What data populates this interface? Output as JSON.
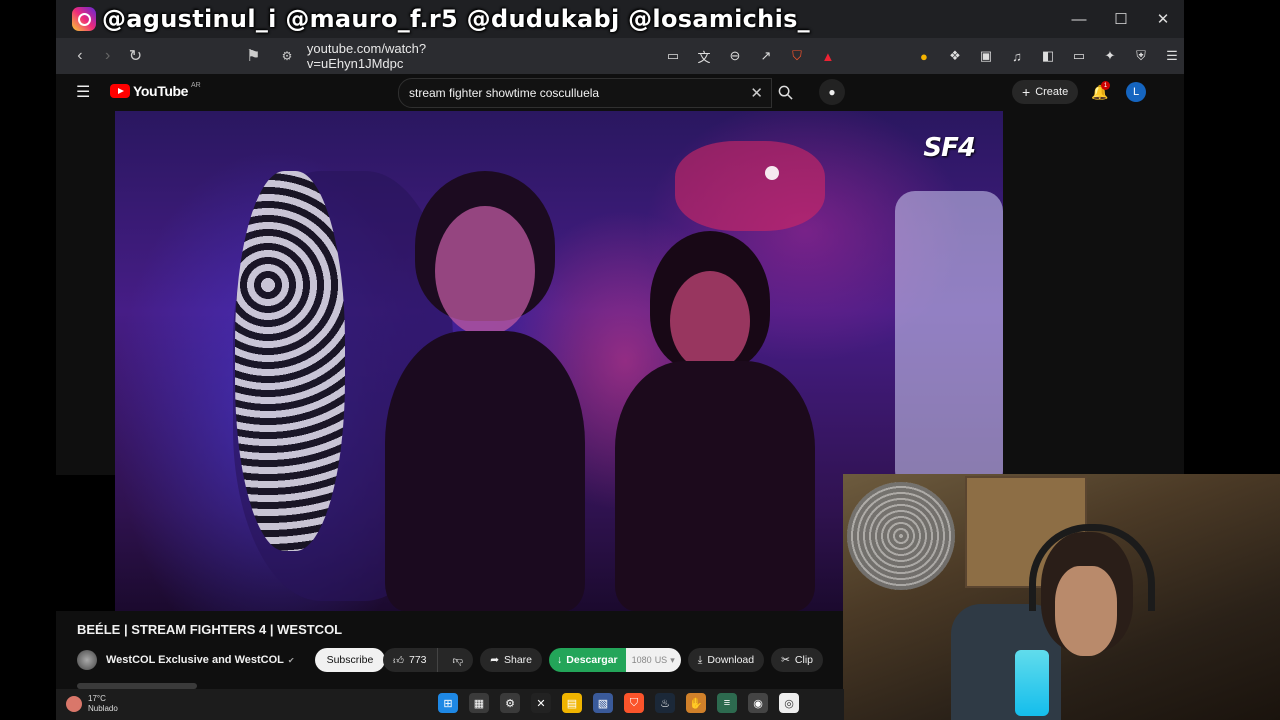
{
  "overlay": {
    "text": "@agustinul_i  @mauro_f.r5  @dudukabj @losamichis_"
  },
  "browser": {
    "url": "youtube.com/watch?v=uEhyn1JMdpc",
    "minimize": "—",
    "maximize": "☐",
    "close": "✕"
  },
  "youtube": {
    "logo": "YouTube",
    "country": "AR",
    "search_value": "stream fighter showtime cosculluela",
    "create_label": "Create",
    "notification_count": "1",
    "avatar_letter": "L",
    "video_logo": "SF4",
    "video_title": "BEÉLE | STREAM FIGHTERS 4 | WESTCOL",
    "channel_name": "WestCOL Exclusive and WestCOL",
    "subscribe_label": "Subscribe",
    "likes": "773",
    "share_label": "Share",
    "descargar_label": "Descargar",
    "quality": "1080",
    "quality_suffix": "US",
    "download_label": "Download",
    "clip_label": "Clip"
  },
  "taskbar": {
    "temperature": "17°C",
    "condition": "Nublado"
  }
}
